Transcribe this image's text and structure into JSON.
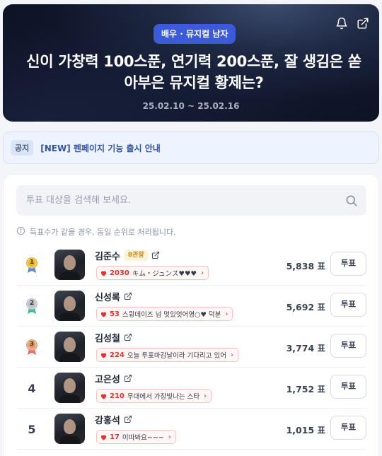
{
  "header": {
    "category": "배우 · 뮤지컬 남자",
    "title": "신이 가창력 100스푼, 연기력 200스푼, 잘 생김은 쏟아부은 뮤지컬 황제는?",
    "period": "25.02.10 ~ 25.02.16",
    "icons": [
      "bell-icon",
      "share-icon"
    ]
  },
  "notice": {
    "tag": "공지",
    "text": "[NEW] 펜페이지 기능 출시 안내"
  },
  "search": {
    "placeholder": "투표 대상을 검색해 보세요."
  },
  "info": {
    "text": "득표수가 같을 경우, 동일 순위로 처리됩니다."
  },
  "colors": {
    "accent": "#3b5bdb",
    "heart": "#e0352f",
    "gold": "#e7b62c",
    "silver": "#b8bfd1",
    "bronze": "#e39a6d"
  },
  "rankings": [
    {
      "rank": "1",
      "medal": "gold",
      "name": "김준수",
      "badge": "8관왕",
      "cheer_count": "2030",
      "cheer_message": "キム・ジュンス♥♥♥",
      "votes": "5,838 표",
      "vote_label": "투표"
    },
    {
      "rank": "2",
      "medal": "silver",
      "name": "신성록",
      "badge": "",
      "cheer_count": "53",
      "cheer_message": "스윙데이즈 넘 멋있엇어영○♥ 덕분",
      "votes": "5,692 표",
      "vote_label": "투표"
    },
    {
      "rank": "3",
      "medal": "bronze",
      "name": "김성철",
      "badge": "",
      "cheer_count": "224",
      "cheer_message": "오늘 투표마감날이라 기다리고 있어",
      "votes": "3,774 표",
      "vote_label": "투표"
    },
    {
      "rank": "4",
      "medal": "",
      "name": "고은성",
      "badge": "",
      "cheer_count": "210",
      "cheer_message": "무대에서 가장빛나는 스타",
      "votes": "1,752 표",
      "vote_label": "투표"
    },
    {
      "rank": "5",
      "medal": "",
      "name": "강홍석",
      "badge": "",
      "cheer_count": "17",
      "cheer_message": "이따봐요~~~",
      "votes": "1,015 표",
      "vote_label": "투표"
    }
  ]
}
